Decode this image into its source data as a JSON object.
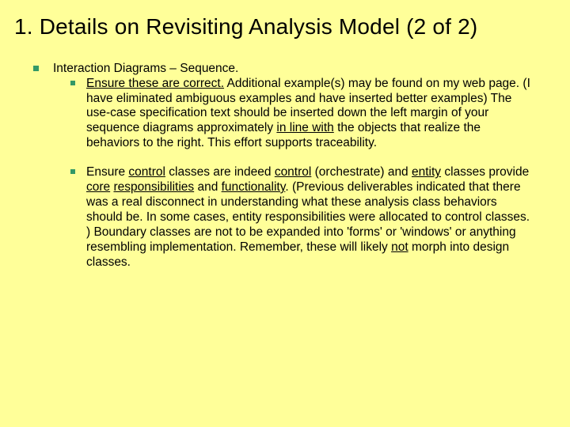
{
  "title": "1.  Details on Revisiting Analysis Model (2 of 2)",
  "lvl1_heading": "Interaction Diagrams – Sequence.",
  "b1": {
    "u1": "Ensure these are correct.",
    "t1": "  Additional example(s) may be found on my web page.  (I have eliminated ambiguous examples and have inserted better examples)   The use-case specification text should be inserted down the left margin of your sequence diagrams approximately ",
    "u2": "in line with",
    "t2": " the objects that realize the behaviors to the right.  This effort supports traceability."
  },
  "b2": {
    "t0": "Ensure ",
    "u1": "control",
    "t1": " classes are indeed ",
    "u2": "control",
    "t2": " (orchestrate) and ",
    "u3": "entity",
    "t3": " classes provide ",
    "u4": "core",
    "t4": " ",
    "u5": "responsibilities",
    "t5": " and ",
    "u6": "functionality",
    "t6": ".  (Previous deliverables indicated that there was a real disconnect in understanding what these analysis class behaviors should be.  In some cases, entity responsibilities were allocated to control classes. )  Boundary classes are not to be expanded into 'forms' or 'windows' or anything resembling implementation.  Remember, these will likely ",
    "u7": "not",
    "t7": " morph into design classes."
  }
}
